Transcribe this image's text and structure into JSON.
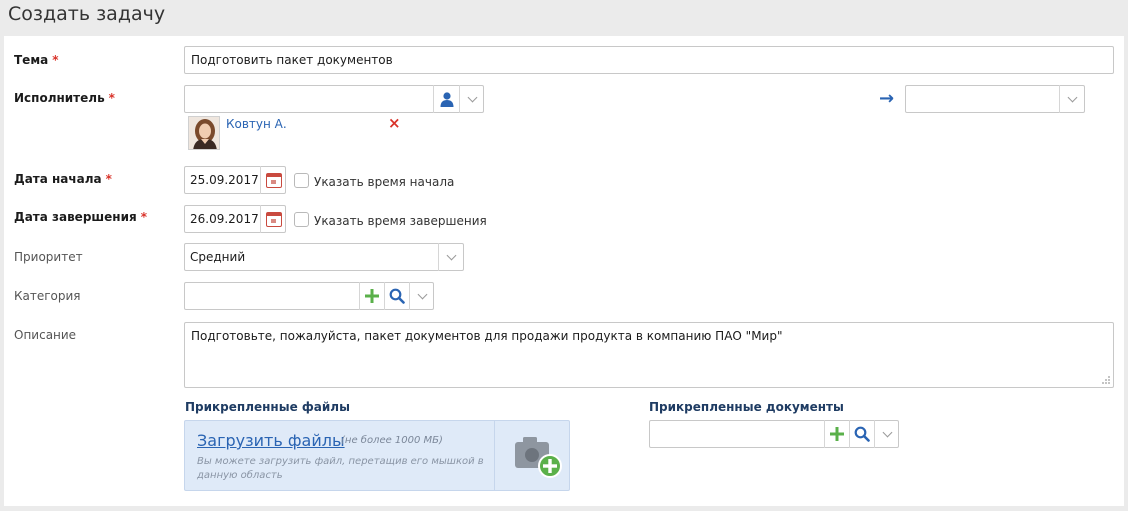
{
  "page": {
    "title": "Создать задачу"
  },
  "form": {
    "subject": {
      "label": "Тема",
      "required_mark": "*",
      "value": "Подготовить пакет документов"
    },
    "assignee": {
      "label": "Исполнитель",
      "required_mark": "*",
      "value": "",
      "selected_name": "Ковтун А.",
      "remove_glyph": "×",
      "arrow_glyph": "→",
      "forward_value": ""
    },
    "start_date": {
      "label": "Дата начала",
      "required_mark": "*",
      "value": "25.09.2017",
      "time_checkbox_label": "Указать время начала"
    },
    "end_date": {
      "label": "Дата завершения",
      "required_mark": "*",
      "value": "26.09.2017",
      "time_checkbox_label": "Указать время завершения"
    },
    "priority": {
      "label": "Приоритет",
      "value": "Средний"
    },
    "category": {
      "label": "Категория",
      "value": ""
    },
    "description": {
      "label": "Описание",
      "value": "Подготовьте, пожалуйста, пакет документов для продажи продукта в компанию ПАО \"Мир\""
    }
  },
  "attachments": {
    "files_title": "Прикрепленные файлы",
    "upload_link": "Загрузить файлы",
    "upload_limit": "(не более 1000 МБ)",
    "upload_hint": "Вы можете загрузить файл, перетащив его мышкой в данную область",
    "documents_title": "Прикрепленные документы",
    "documents_value": ""
  },
  "colors": {
    "accent_blue": "#2a64b3",
    "required_red": "#d9332a",
    "add_green": "#5ab04a",
    "dropzone_bg": "#dfeaf8"
  },
  "icons": [
    "user-icon",
    "chevron-down-icon",
    "arrow-right-icon",
    "remove-icon",
    "calendar-icon",
    "plus-icon",
    "search-icon",
    "camera-add-icon",
    "resize-grip-icon"
  ]
}
